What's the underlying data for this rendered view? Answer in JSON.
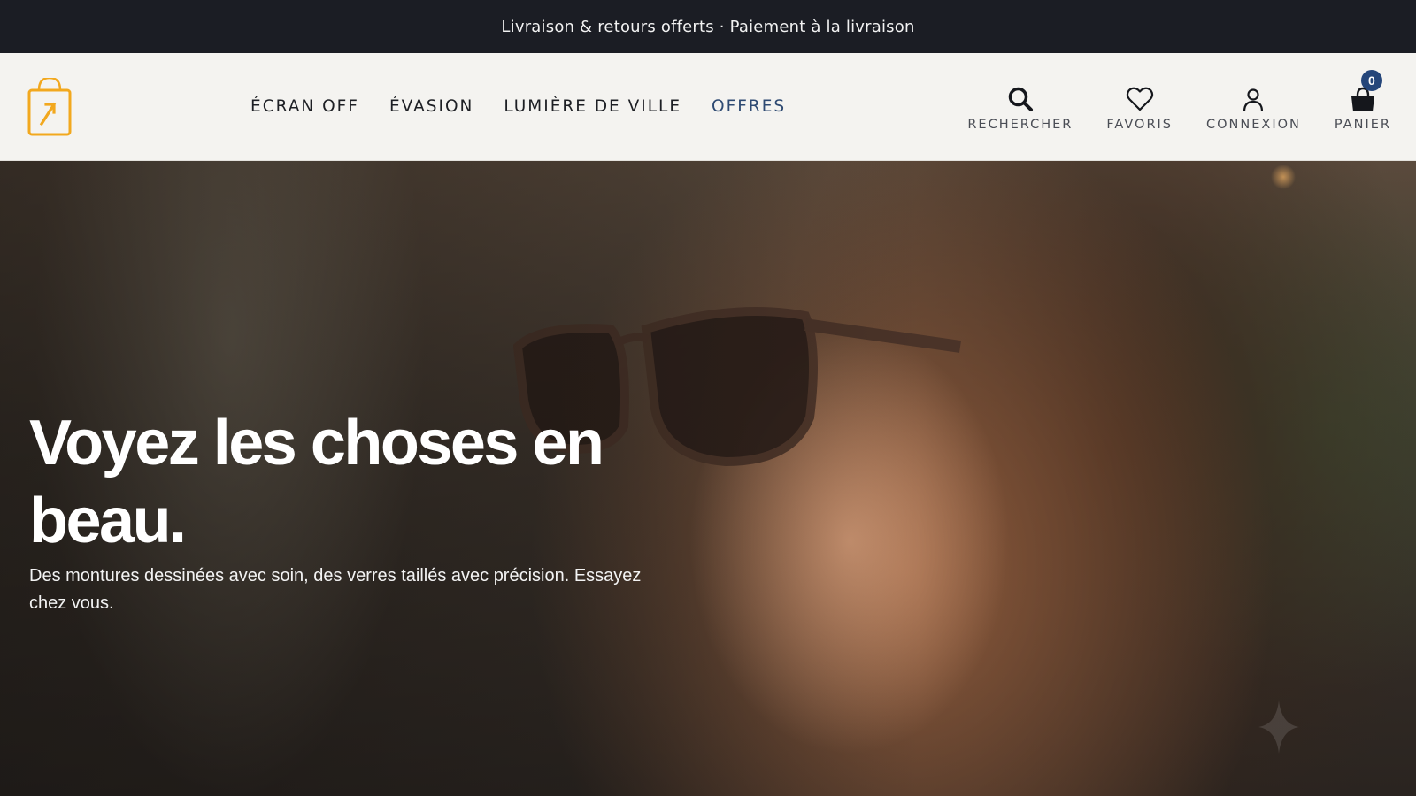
{
  "announcement": "Livraison & retours offerts · Paiement à la livraison",
  "brand": {
    "logo_icon": "shopping-bag-logo",
    "accent": "#f2a81e"
  },
  "nav": {
    "items": [
      {
        "label": "ÉCRAN OFF"
      },
      {
        "label": "ÉVASION"
      },
      {
        "label": "LUMIÈRE DE VILLE"
      },
      {
        "label": "OFFRES"
      }
    ],
    "accent_color": "#2e4a72"
  },
  "actions": {
    "search": {
      "label": "RECHERCHER",
      "icon": "search-icon"
    },
    "favorites": {
      "label": "FAVORIS",
      "icon": "heart-icon"
    },
    "login": {
      "label": "CONNEXION",
      "icon": "user-icon"
    },
    "cart": {
      "label": "PANIER",
      "icon": "cart-icon",
      "count": "0"
    }
  },
  "hero": {
    "title": "Voyez les choses en beau.",
    "subtitle": "Des montures dessinées avec soin, des verres taillés avec précision. Essayez chez vous.",
    "image_icon": "woman-sunglasses-photo"
  }
}
